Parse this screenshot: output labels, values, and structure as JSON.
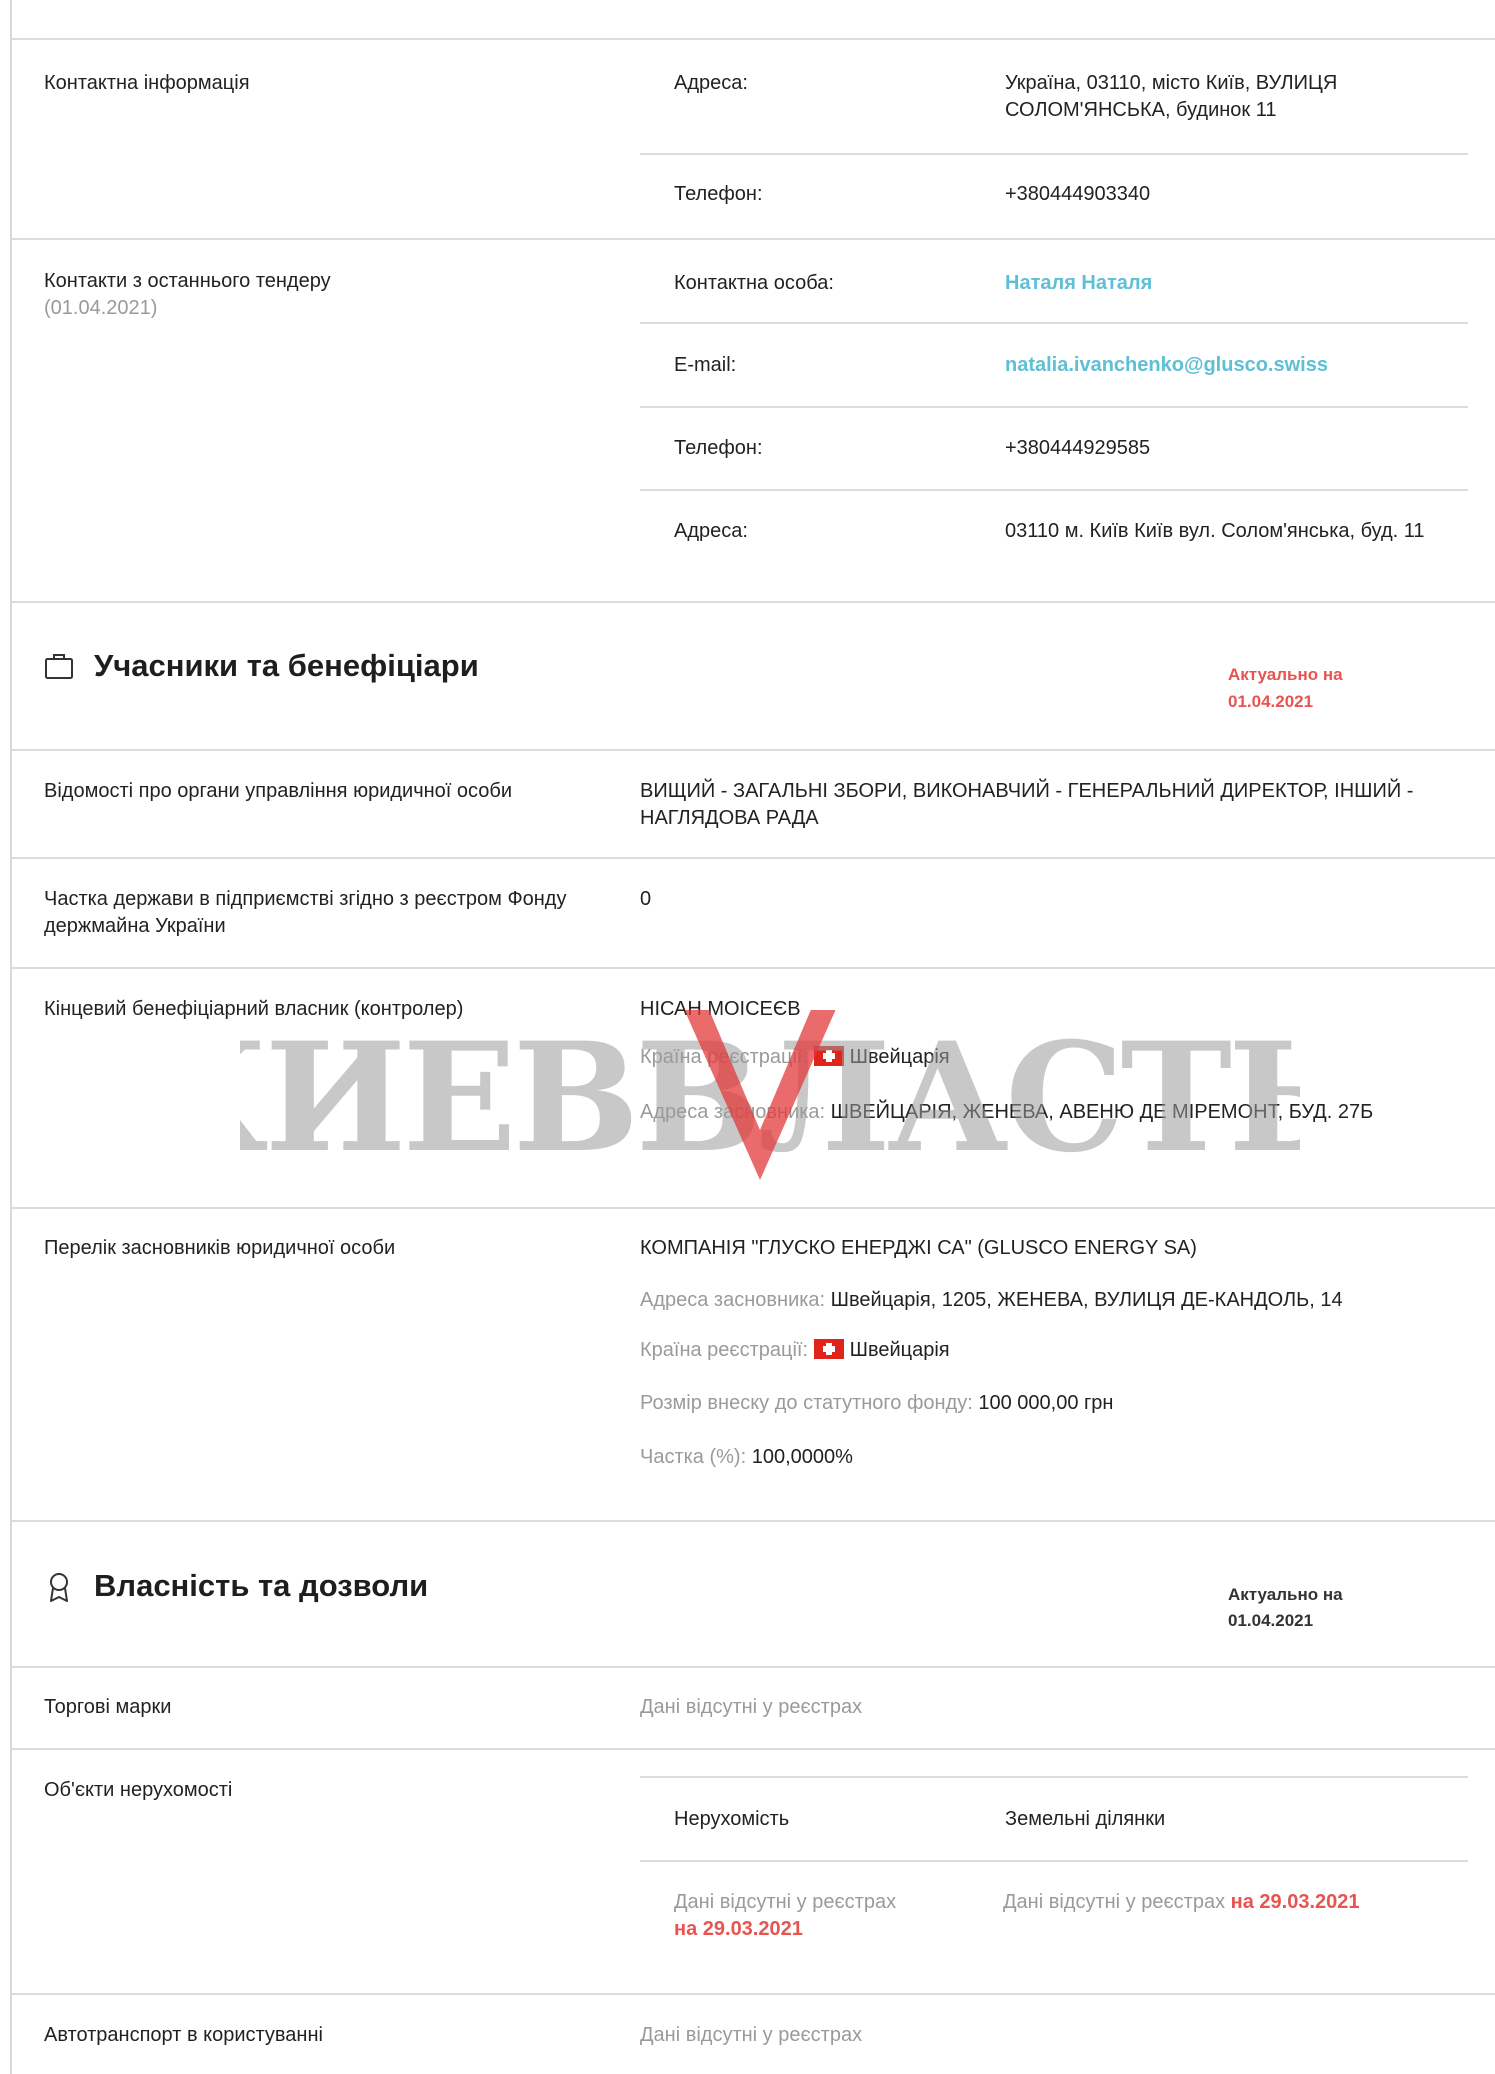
{
  "contact_info": {
    "label": "Контактна інформація",
    "address_label": "Адреса:",
    "address_value": "Україна, 03110, місто Київ, ВУЛИЦЯ СОЛОМ'ЯНСЬКА, будинок 11",
    "phone_label": "Телефон:",
    "phone_value": "+380444903340"
  },
  "last_tender_contacts": {
    "label": "Контакти з останнього тендеру",
    "date": "(01.04.2021)",
    "person_label": "Контактна особа:",
    "person_value": "Наталя Наталя",
    "email_label": "E-mail:",
    "email_value": "natalia.ivanchenko@glusco.swiss",
    "phone_label": "Телефон:",
    "phone_value": "+380444929585",
    "address_label": "Адреса:",
    "address_value": "03110 м. Київ Київ вул. Солом'янська, буд. 11"
  },
  "participants": {
    "title": "Учасники та бенефіціари",
    "actual_label": "Актуально на",
    "actual_date": "01.04.2021",
    "governance_label": "Відомості про органи управління юридичної особи",
    "governance_value": "ВИЩИЙ - ЗАГАЛЬНІ ЗБОРИ, ВИКОНАВЧИЙ - ГЕНЕРАЛЬНИЙ ДИРЕКТОР, ІНШИЙ - НАГЛЯДОВА РАДА",
    "state_share_label": "Частка держави в підприємстві згідно з реєстром Фонду держмайна України",
    "state_share_value": "0",
    "beneficiary_label": "Кінцевий бенефіціарний власник (контролер)",
    "beneficiary_name": "НІСАН МОІСЕЄВ",
    "beneficiary_country_label": "Країна реєстрації:",
    "beneficiary_country_value": "Швейцарія",
    "beneficiary_address_label": "Адреса засновника:",
    "beneficiary_address_value": "ШВЕЙЦАРІЯ, ЖЕНЕВА, АВЕНЮ ДЕ МІРЕМОНТ, БУД. 27Б",
    "founders_label": "Перелік засновників юридичної особи",
    "founder_name": "КОМПАНІЯ \"ГЛУСКО ЕНЕРДЖІ СА\" (GLUSCO ENERGY SA)",
    "founder_address_label": "Адреса засновника:",
    "founder_address_value": "Швейцарія, 1205, ЖЕНЕВА, ВУЛИЦЯ ДЕ-КАНДОЛЬ, 14",
    "founder_country_label": "Країна реєстрації:",
    "founder_country_value": "Швейцарія",
    "founder_capital_label": "Розмір внеску до статутного фонду:",
    "founder_capital_value": "100 000,00 грн",
    "founder_share_label": "Частка (%):",
    "founder_share_value": "100,0000%"
  },
  "property": {
    "title": "Власність та дозволи",
    "actual_label": "Актуально на",
    "actual_date": "01.04.2021",
    "trademarks_label": "Торгові марки",
    "trademarks_value": "Дані відсутні у реєстрах",
    "realty_label": "Об'єкти нерухомості",
    "realty_col1": "Нерухомість",
    "realty_col2": "Земельні ділянки",
    "realty_val1": "Дані відсутні у реєстрах",
    "realty_val1_date": "на 29.03.2021",
    "realty_val2": "Дані відсутні у реєстрах",
    "realty_val2_date": "на 29.03.2021",
    "vehicles_label": "Автотранспорт в користуванні",
    "vehicles_value": "Дані відсутні у реєстрах"
  },
  "watermark": {
    "text": "КИЕВВЛАСТЬ"
  },
  "colors": {
    "link": "#5ebfd6",
    "accent_red": "#e85450",
    "muted": "#9a9a9a",
    "rule": "#dcdcdc"
  }
}
